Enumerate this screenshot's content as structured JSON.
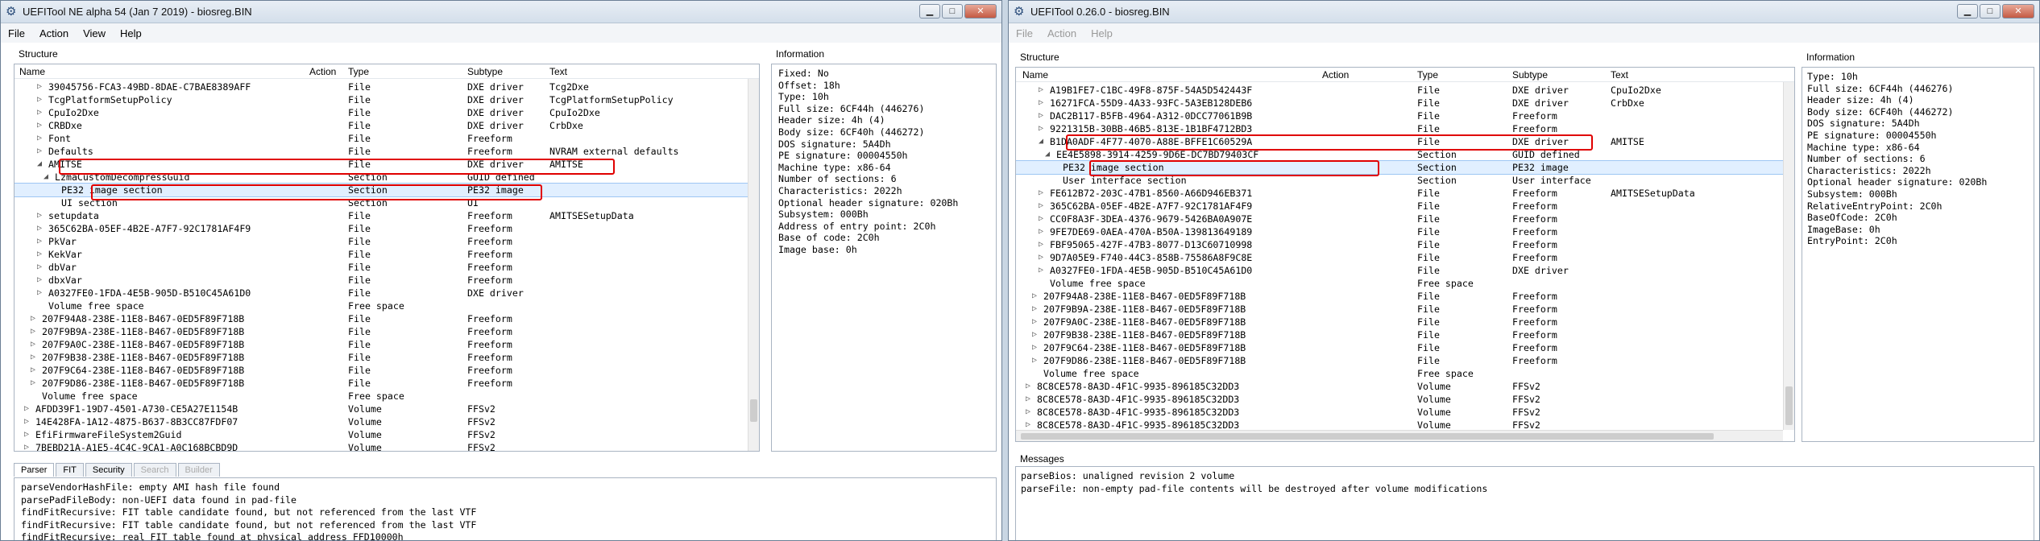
{
  "win1": {
    "title": "UEFITool NE alpha 54 (Jan  7 2019) - biosreg.BIN",
    "menu": [
      "File",
      "Action",
      "View",
      "Help"
    ],
    "structure_label": "Structure",
    "info_label": "Information",
    "columns": [
      "Name",
      "Action",
      "Type",
      "Subtype",
      "Text"
    ],
    "rows": [
      {
        "indent": 3,
        "exp": "▷",
        "name": "39045756-FCA3-49BD-8DAE-C7BAE8389AFF",
        "type": "File",
        "subtype": "DXE driver",
        "text": "Tcg2Dxe"
      },
      {
        "indent": 3,
        "exp": "▷",
        "name": "TcgPlatformSetupPolicy",
        "type": "File",
        "subtype": "DXE driver",
        "text": "TcgPlatformSetupPolicy"
      },
      {
        "indent": 3,
        "exp": "▷",
        "name": "CpuIo2Dxe",
        "type": "File",
        "subtype": "DXE driver",
        "text": "CpuIo2Dxe"
      },
      {
        "indent": 3,
        "exp": "▷",
        "name": "CRBDxe",
        "type": "File",
        "subtype": "DXE driver",
        "text": "CrbDxe"
      },
      {
        "indent": 3,
        "exp": "▷",
        "name": "Font",
        "type": "File",
        "subtype": "Freeform",
        "text": ""
      },
      {
        "indent": 3,
        "exp": "▷",
        "name": "Defaults",
        "type": "File",
        "subtype": "Freeform",
        "text": "NVRAM external defaults"
      },
      {
        "indent": 3,
        "exp": "◢",
        "name": "AMITSE",
        "type": "File",
        "subtype": "DXE driver",
        "text": "AMITSE"
      },
      {
        "indent": 4,
        "exp": "◢",
        "name": "LzmaCustomDecompressGuid",
        "type": "Section",
        "subtype": "GUID defined",
        "text": ""
      },
      {
        "indent": 5,
        "exp": "",
        "name": "PE32 image section",
        "type": "Section",
        "subtype": "PE32 image",
        "text": "",
        "sel": true
      },
      {
        "indent": 5,
        "exp": "",
        "name": "UI section",
        "type": "Section",
        "subtype": "UI",
        "text": ""
      },
      {
        "indent": 3,
        "exp": "▷",
        "name": "setupdata",
        "type": "File",
        "subtype": "Freeform",
        "text": "AMITSESetupData"
      },
      {
        "indent": 3,
        "exp": "▷",
        "name": "365C62BA-05EF-4B2E-A7F7-92C1781AF4F9",
        "type": "File",
        "subtype": "Freeform",
        "text": ""
      },
      {
        "indent": 3,
        "exp": "▷",
        "name": "PkVar",
        "type": "File",
        "subtype": "Freeform",
        "text": ""
      },
      {
        "indent": 3,
        "exp": "▷",
        "name": "KekVar",
        "type": "File",
        "subtype": "Freeform",
        "text": ""
      },
      {
        "indent": 3,
        "exp": "▷",
        "name": "dbVar",
        "type": "File",
        "subtype": "Freeform",
        "text": ""
      },
      {
        "indent": 3,
        "exp": "▷",
        "name": "dbxVar",
        "type": "File",
        "subtype": "Freeform",
        "text": ""
      },
      {
        "indent": 3,
        "exp": "▷",
        "name": "A0327FE0-1FDA-4E5B-905D-B510C45A61D0",
        "type": "File",
        "subtype": "DXE driver",
        "text": ""
      },
      {
        "indent": 3,
        "exp": "",
        "name": "Volume free space",
        "type": "Free space",
        "subtype": "",
        "text": ""
      },
      {
        "indent": 2,
        "exp": "▷",
        "name": "207F94A8-238E-11E8-B467-0ED5F89F718B",
        "type": "File",
        "subtype": "Freeform",
        "text": ""
      },
      {
        "indent": 2,
        "exp": "▷",
        "name": "207F9B9A-238E-11E8-B467-0ED5F89F718B",
        "type": "File",
        "subtype": "Freeform",
        "text": ""
      },
      {
        "indent": 2,
        "exp": "▷",
        "name": "207F9A0C-238E-11E8-B467-0ED5F89F718B",
        "type": "File",
        "subtype": "Freeform",
        "text": ""
      },
      {
        "indent": 2,
        "exp": "▷",
        "name": "207F9B38-238E-11E8-B467-0ED5F89F718B",
        "type": "File",
        "subtype": "Freeform",
        "text": ""
      },
      {
        "indent": 2,
        "exp": "▷",
        "name": "207F9C64-238E-11E8-B467-0ED5F89F718B",
        "type": "File",
        "subtype": "Freeform",
        "text": ""
      },
      {
        "indent": 2,
        "exp": "▷",
        "name": "207F9D86-238E-11E8-B467-0ED5F89F718B",
        "type": "File",
        "subtype": "Freeform",
        "text": ""
      },
      {
        "indent": 2,
        "exp": "",
        "name": "Volume free space",
        "type": "Free space",
        "subtype": "",
        "text": ""
      },
      {
        "indent": 1,
        "exp": "▷",
        "name": "AFDD39F1-19D7-4501-A730-CE5A27E1154B",
        "type": "Volume",
        "subtype": "FFSv2",
        "text": ""
      },
      {
        "indent": 1,
        "exp": "▷",
        "name": "14E428FA-1A12-4875-B637-8B3CC87FDF07",
        "type": "Volume",
        "subtype": "FFSv2",
        "text": ""
      },
      {
        "indent": 1,
        "exp": "▷",
        "name": "EfiFirmwareFileSystem2Guid",
        "type": "Volume",
        "subtype": "FFSv2",
        "text": ""
      },
      {
        "indent": 1,
        "exp": "▷",
        "name": "7BEBD21A-A1E5-4C4C-9CA1-A0C168BCBD9D",
        "type": "Volume",
        "subtype": "FFSv2",
        "text": ""
      }
    ],
    "info_lines": [
      "Fixed: No",
      "Offset: 18h",
      "Type: 10h",
      "Full size: 6CF44h (446276)",
      "Header size: 4h (4)",
      "Body size: 6CF40h (446272)",
      "DOS signature: 5A4Dh",
      "PE signature: 00004550h",
      "Machine type: x86-64",
      "Number of sections: 6",
      "Characteristics: 2022h",
      "Optional header signature: 020Bh",
      "Subsystem: 000Bh",
      "Address of entry point: 2C0h",
      "Base of code: 2C0h",
      "Image base: 0h"
    ],
    "tabs": [
      {
        "label": "Parser",
        "active": true,
        "disabled": false
      },
      {
        "label": "FIT",
        "active": false,
        "disabled": false
      },
      {
        "label": "Security",
        "active": false,
        "disabled": false
      },
      {
        "label": "Search",
        "active": false,
        "disabled": true
      },
      {
        "label": "Builder",
        "active": false,
        "disabled": true
      }
    ],
    "messages": [
      "parseVendorHashFile: empty AMI hash file found",
      "parsePadFileBody: non-UEFI data found in pad-file",
      "findFitRecursive: FIT table candidate found, but not referenced from the last VTF",
      "findFitRecursive: FIT table candidate found, but not referenced from the last VTF",
      "findFitRecursive: real FIT table found at physical address FFD10000h"
    ]
  },
  "win2": {
    "title": "UEFITool 0.26.0 - biosreg.BIN",
    "menu": [
      "File",
      "Action",
      "Help"
    ],
    "structure_label": "Structure",
    "info_label": "Information",
    "messages_label": "Messages",
    "columns": [
      "Name",
      "Action",
      "Type",
      "Subtype",
      "Text"
    ],
    "rows": [
      {
        "indent": 3,
        "exp": "▷",
        "name": "A19B1FE7-C1BC-49F8-875F-54A5D542443F",
        "type": "File",
        "subtype": "DXE driver",
        "text": "CpuIo2Dxe"
      },
      {
        "indent": 3,
        "exp": "▷",
        "name": "16271FCA-55D9-4A33-93FC-5A3EB128DEB6",
        "type": "File",
        "subtype": "DXE driver",
        "text": "CrbDxe"
      },
      {
        "indent": 3,
        "exp": "▷",
        "name": "DAC2B117-B5FB-4964-A312-0DCC77061B9B",
        "type": "File",
        "subtype": "Freeform",
        "text": ""
      },
      {
        "indent": 3,
        "exp": "▷",
        "name": "9221315B-30BB-46B5-813E-1B1BF4712BD3",
        "type": "File",
        "subtype": "Freeform",
        "text": ""
      },
      {
        "indent": 3,
        "exp": "◢",
        "name": "B1DA0ADF-4F77-4070-A88E-BFFE1C60529A",
        "type": "File",
        "subtype": "DXE driver",
        "text": "AMITSE"
      },
      {
        "indent": 4,
        "exp": "◢",
        "name": "EE4E5898-3914-4259-9D6E-DC7BD79403CF",
        "type": "Section",
        "subtype": "GUID defined",
        "text": ""
      },
      {
        "indent": 5,
        "exp": "",
        "name": "PE32 image section",
        "type": "Section",
        "subtype": "PE32 image",
        "text": "",
        "sel": true
      },
      {
        "indent": 5,
        "exp": "",
        "name": "User interface section",
        "type": "Section",
        "subtype": "User interface",
        "text": ""
      },
      {
        "indent": 3,
        "exp": "▷",
        "name": "FE612B72-203C-47B1-8560-A66D946EB371",
        "type": "File",
        "subtype": "Freeform",
        "text": "AMITSESetupData"
      },
      {
        "indent": 3,
        "exp": "▷",
        "name": "365C62BA-05EF-4B2E-A7F7-92C1781AF4F9",
        "type": "File",
        "subtype": "Freeform",
        "text": ""
      },
      {
        "indent": 3,
        "exp": "▷",
        "name": "CC0F8A3F-3DEA-4376-9679-5426BA0A907E",
        "type": "File",
        "subtype": "Freeform",
        "text": ""
      },
      {
        "indent": 3,
        "exp": "▷",
        "name": "9FE7DE69-0AEA-470A-B50A-139813649189",
        "type": "File",
        "subtype": "Freeform",
        "text": ""
      },
      {
        "indent": 3,
        "exp": "▷",
        "name": "FBF95065-427F-47B3-8077-D13C60710998",
        "type": "File",
        "subtype": "Freeform",
        "text": ""
      },
      {
        "indent": 3,
        "exp": "▷",
        "name": "9D7A05E9-F740-44C3-858B-75586A8F9C8E",
        "type": "File",
        "subtype": "Freeform",
        "text": ""
      },
      {
        "indent": 3,
        "exp": "▷",
        "name": "A0327FE0-1FDA-4E5B-905D-B510C45A61D0",
        "type": "File",
        "subtype": "DXE driver",
        "text": ""
      },
      {
        "indent": 3,
        "exp": "",
        "name": "Volume free space",
        "type": "Free space",
        "subtype": "",
        "text": ""
      },
      {
        "indent": 2,
        "exp": "▷",
        "name": "207F94A8-238E-11E8-B467-0ED5F89F718B",
        "type": "File",
        "subtype": "Freeform",
        "text": ""
      },
      {
        "indent": 2,
        "exp": "▷",
        "name": "207F9B9A-238E-11E8-B467-0ED5F89F718B",
        "type": "File",
        "subtype": "Freeform",
        "text": ""
      },
      {
        "indent": 2,
        "exp": "▷",
        "name": "207F9A0C-238E-11E8-B467-0ED5F89F718B",
        "type": "File",
        "subtype": "Freeform",
        "text": ""
      },
      {
        "indent": 2,
        "exp": "▷",
        "name": "207F9B38-238E-11E8-B467-0ED5F89F718B",
        "type": "File",
        "subtype": "Freeform",
        "text": ""
      },
      {
        "indent": 2,
        "exp": "▷",
        "name": "207F9C64-238E-11E8-B467-0ED5F89F718B",
        "type": "File",
        "subtype": "Freeform",
        "text": ""
      },
      {
        "indent": 2,
        "exp": "▷",
        "name": "207F9D86-238E-11E8-B467-0ED5F89F718B",
        "type": "File",
        "subtype": "Freeform",
        "text": ""
      },
      {
        "indent": 2,
        "exp": "",
        "name": "Volume free space",
        "type": "Free space",
        "subtype": "",
        "text": ""
      },
      {
        "indent": 1,
        "exp": "▷",
        "name": "8C8CE578-8A3D-4F1C-9935-896185C32DD3",
        "type": "Volume",
        "subtype": "FFSv2",
        "text": ""
      },
      {
        "indent": 1,
        "exp": "▷",
        "name": "8C8CE578-8A3D-4F1C-9935-896185C32DD3",
        "type": "Volume",
        "subtype": "FFSv2",
        "text": ""
      },
      {
        "indent": 1,
        "exp": "▷",
        "name": "8C8CE578-8A3D-4F1C-9935-896185C32DD3",
        "type": "Volume",
        "subtype": "FFSv2",
        "text": ""
      },
      {
        "indent": 1,
        "exp": "▷",
        "name": "8C8CE578-8A3D-4F1C-9935-896185C32DD3",
        "type": "Volume",
        "subtype": "FFSv2",
        "text": ""
      }
    ],
    "info_lines": [
      "Type: 10h",
      "Full size: 6CF44h (446276)",
      "Header size: 4h (4)",
      "Body size: 6CF40h (446272)",
      "DOS signature: 5A4Dh",
      "PE signature: 00004550h",
      "Machine type: x86-64",
      "Number of sections: 6",
      "Characteristics: 2022h",
      "Optional header signature: 020Bh",
      "Subsystem: 000Bh",
      "RelativeEntryPoint: 2C0h",
      "BaseOfCode: 2C0h",
      "ImageBase: 0h",
      "EntryPoint: 2C0h"
    ],
    "messages": [
      "parseBios: unaligned revision 2 volume",
      "parseFile: non-empty pad-file contents will be destroyed after volume modifications"
    ]
  },
  "colors": {
    "highlight": "#e00000",
    "selection": "#e1efff"
  }
}
